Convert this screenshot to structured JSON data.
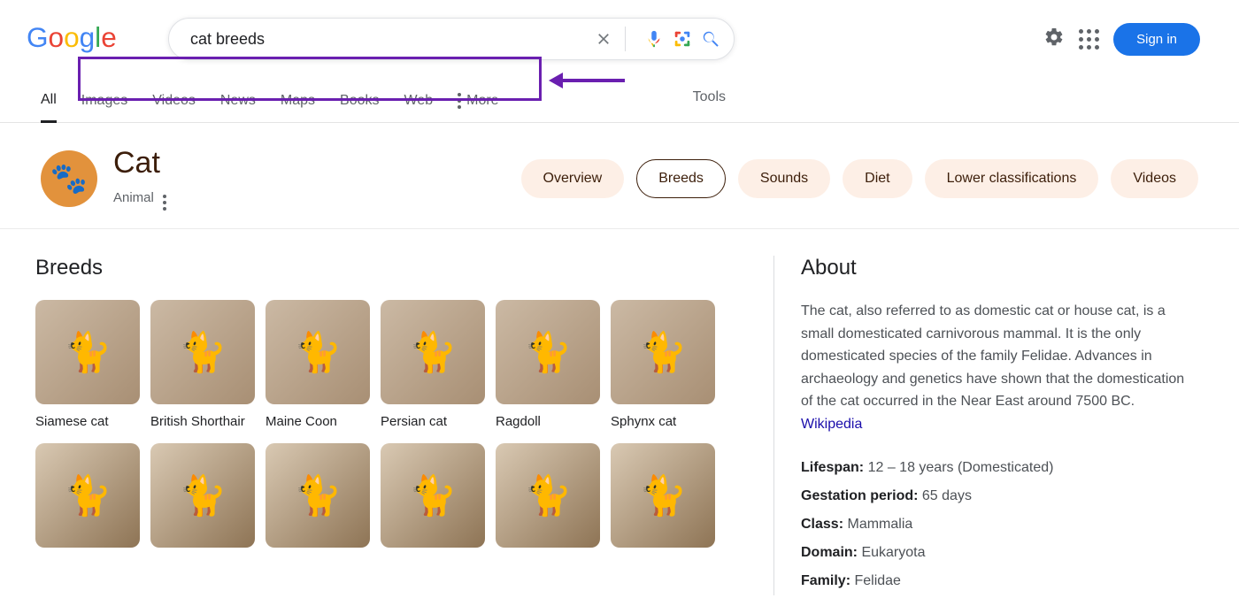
{
  "search": {
    "query": "cat breeds"
  },
  "tabs": {
    "all": "All",
    "images": "Images",
    "videos": "Videos",
    "news": "News",
    "maps": "Maps",
    "books": "Books",
    "web": "Web",
    "more": "More",
    "tools": "Tools"
  },
  "signin": "Sign in",
  "entity": {
    "title": "Cat",
    "subtitle": "Animal"
  },
  "chips": {
    "overview": "Overview",
    "breeds": "Breeds",
    "sounds": "Sounds",
    "diet": "Diet",
    "lower": "Lower classifications",
    "videos": "Videos"
  },
  "breeds": {
    "heading": "Breeds",
    "row1": [
      {
        "name": "Siamese cat"
      },
      {
        "name": "British Shorthair"
      },
      {
        "name": "Maine Coon"
      },
      {
        "name": "Persian cat"
      },
      {
        "name": "Ragdoll"
      },
      {
        "name": "Sphynx cat"
      }
    ],
    "row2": [
      {
        "name": ""
      },
      {
        "name": ""
      },
      {
        "name": ""
      },
      {
        "name": ""
      },
      {
        "name": ""
      },
      {
        "name": ""
      }
    ]
  },
  "about": {
    "heading": "About",
    "text": "The cat, also referred to as domestic cat or house cat, is a small domesticated carnivorous mammal. It is the only domesticated species of the family Felidae. Advances in archaeology and genetics have shown that the domestication of the cat occurred in the Near East around 7500 BC. ",
    "source": "Wikipedia",
    "facts": {
      "lifespan_k": "Lifespan:",
      "lifespan_v": "12 – 18 years (Domesticated)",
      "gestation_k": "Gestation period:",
      "gestation_v": "65 days",
      "class_k": "Class:",
      "class_v": "Mammalia",
      "domain_k": "Domain:",
      "domain_v": "Eukaryota",
      "family_k": "Family:",
      "family_v": "Felidae"
    }
  }
}
